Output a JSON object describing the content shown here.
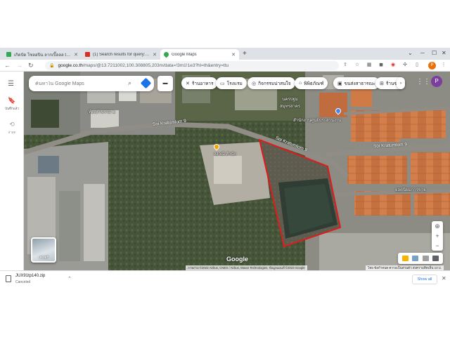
{
  "tabs": [
    {
      "title": "เกิดปัด โซลฮปิน ลากเปิ๊ลลล tot tonนะ",
      "favicon_color": "#34a853"
    },
    {
      "title": "(1) Search results for query: blac",
      "favicon_color": "#d93025"
    },
    {
      "title": "Google Maps",
      "favicon_color": "#34a853"
    }
  ],
  "omnibox": {
    "host": "google.co.th",
    "path": "/maps/@13.7211002,100.308805,203m/data=!3m1!1e3?hl=th&entry=ttu"
  },
  "rail": {
    "saved_label": "บันทึกแล้ว",
    "recent_label": "ล่าสุด"
  },
  "search": {
    "placeholder": "ค้นหาใน Google Maps"
  },
  "chips": [
    {
      "icon": "🍴",
      "label": "ร้านอาหาร"
    },
    {
      "icon": "🛏",
      "label": "โรงแรม"
    },
    {
      "icon": "📷",
      "label": "กิจกรรมน่าสนใจ"
    },
    {
      "icon": "🏛",
      "label": "พิพิธภัณฑ์"
    },
    {
      "icon": "🚌",
      "label": "ขนส่งสาธารณะ"
    },
    {
      "icon": "💊",
      "label": "ร้านข"
    }
  ],
  "profile_initial": "P",
  "map_labels": {
    "road_1": "Soi Kratumlom 9",
    "road_2": "Soi Kratumlom 9",
    "road_3": "Soi Kratumlom 9",
    "poi_1": "ท้องตำบรวม ๒",
    "poi_2": "นครปฐม\nสมุทรสาคร",
    "poi_3": "สำนักงานศูนย์ประสานงาน",
    "poi_4": "ลงวณี สำนัก",
    "poi_5": "ยอดนิยมการขาย",
    "satellite_label": "เลเยอร์"
  },
  "attribution": "ภาพถ่าย ©2023 Airbus, CNES / Airbus, Maxar Technologies, ข้อมูลแผนที่ ©2023 Google",
  "scale_text": "ไทย  ข้อกำหนด  ความเป็นส่วนตัว  ส่งความคิดเห็น  10 ม.",
  "google_logo": "Google",
  "download": {
    "filename": "JUX91tp140.zip",
    "status": "Canceled",
    "show_all": "Show all"
  },
  "colors": {
    "highlight": "#e01b1b",
    "accent": "#1a73e8"
  }
}
